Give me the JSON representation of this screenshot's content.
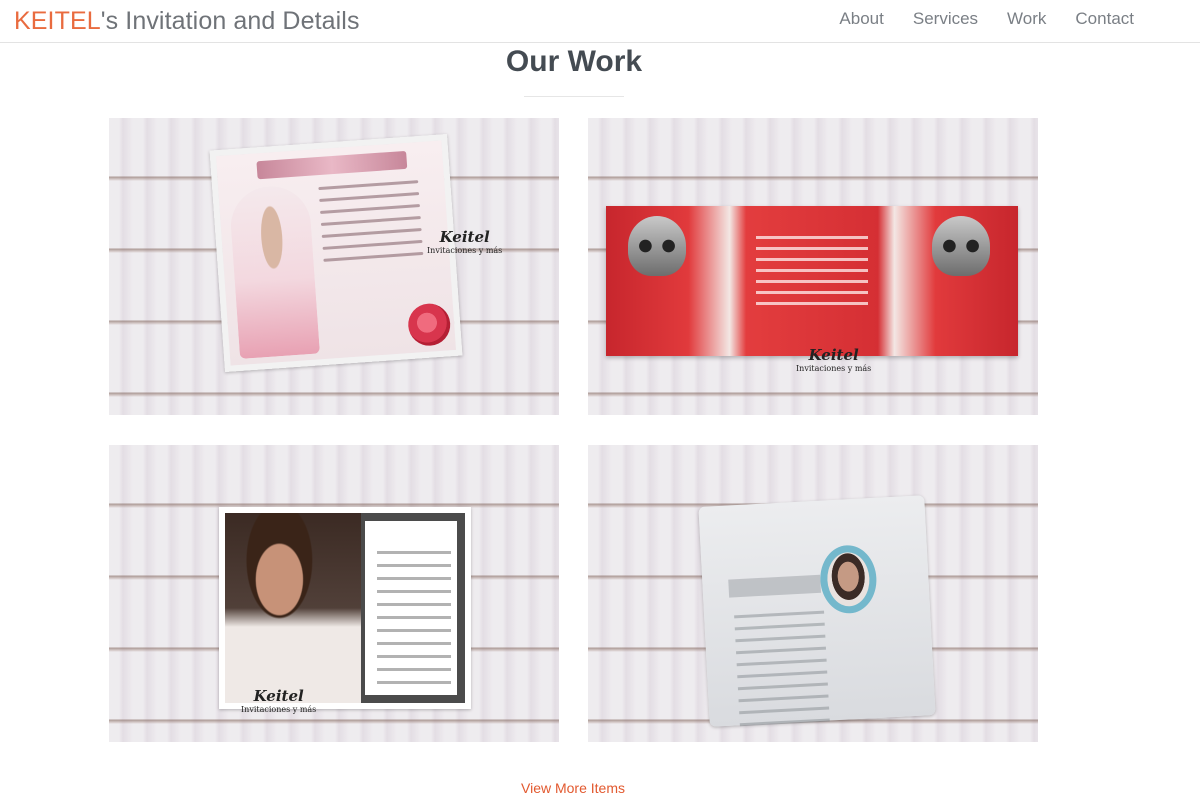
{
  "navbar": {
    "brand_accent": "KEITEL",
    "brand_rest": "'s Invitation and Details",
    "links": [
      "About",
      "Services",
      "Work",
      "Contact"
    ]
  },
  "section": {
    "title": "Our Work",
    "more_link": "View More Items"
  },
  "gallery": [
    {
      "watermark_name": "Keitel",
      "watermark_sub": "Invitaciones y más"
    },
    {
      "watermark_name": "Keitel",
      "watermark_sub": "Invitaciones y más"
    },
    {
      "watermark_name": "Keitel",
      "watermark_sub": "Invitaciones y más"
    }
  ],
  "colors": {
    "accent": "#e96b3f",
    "link": "#e2592f",
    "heading": "#444b52",
    "nav_text": "#7a7f85"
  }
}
